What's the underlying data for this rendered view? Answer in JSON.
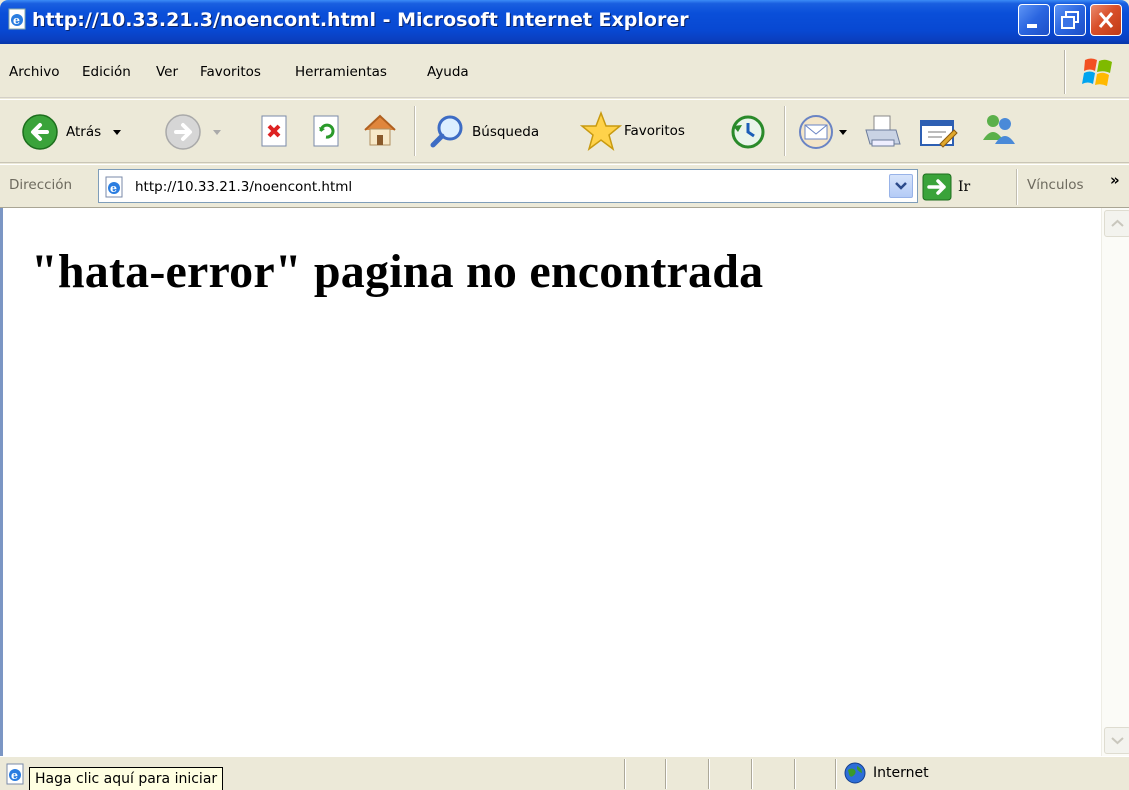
{
  "window": {
    "title": "http://10.33.21.3/noencont.html - Microsoft Internet Explorer"
  },
  "menu": {
    "items": [
      "Archivo",
      "Edición",
      "Ver",
      "Favoritos",
      "Herramientas",
      "Ayuda"
    ]
  },
  "toolbar": {
    "back_label": "Atrás",
    "search_label": "Búsqueda",
    "favorites_label": "Favoritos"
  },
  "address": {
    "label": "Dirección",
    "url": "http://10.33.21.3/noencont.html",
    "go_label": "Ir",
    "links_label": "Vínculos",
    "links_chevron": "»"
  },
  "page": {
    "heading": "\"hata-error\" pagina no encontrada"
  },
  "status": {
    "tooltip": "Haga clic aquí para iniciar",
    "zone": "Internet"
  },
  "colors": {
    "titlebar": "#0848d2",
    "chrome": "#ece9d8",
    "tooltip_bg": "#ffffe1"
  }
}
